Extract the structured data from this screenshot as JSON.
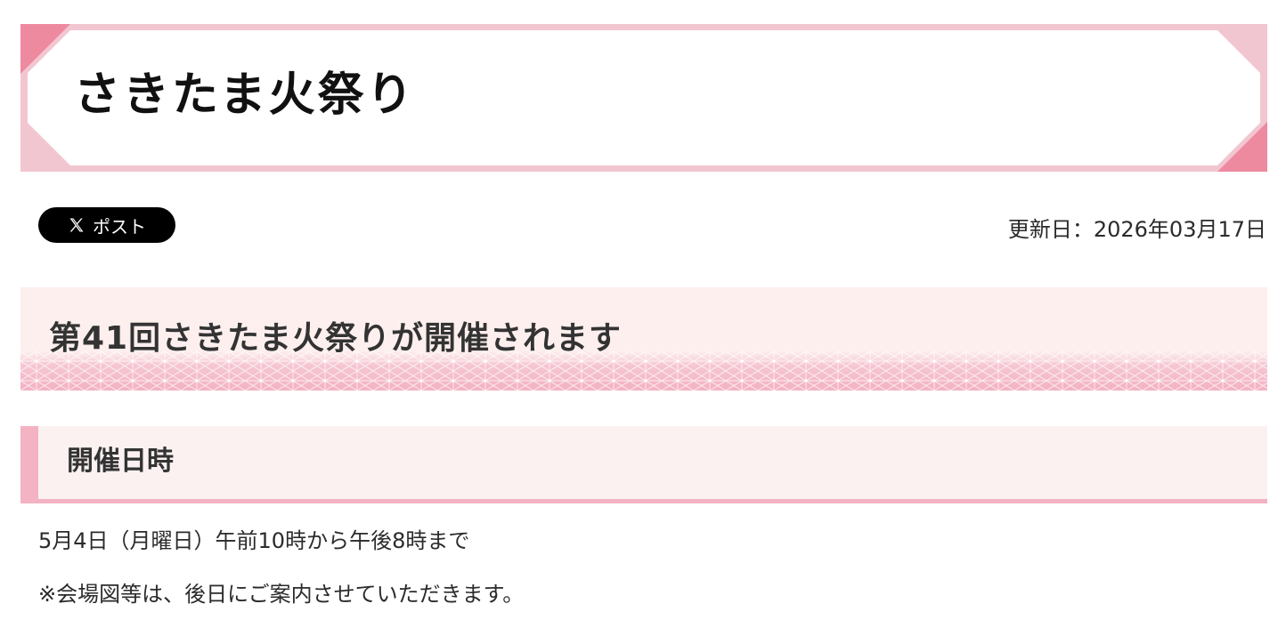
{
  "page": {
    "title": "さきたま火祭り"
  },
  "share": {
    "post_label": "ポスト",
    "icon": "x-logo-icon"
  },
  "updated": {
    "text": "更新日：2026年03月17日"
  },
  "section": {
    "heading": "第41回さきたま火祭りが開催されます"
  },
  "subsection": {
    "heading": "開催日時",
    "paragraphs": [
      "5月4日（月曜日）午前10時から午後8時まで",
      "※会場図等は、後日にご案内させていただきます。"
    ]
  },
  "colors": {
    "accent_pink": "#ee8aa0",
    "light_pink": "#f2c6d1",
    "banner_bg": "#fcefee",
    "heading_bar": "#f3b3c3"
  }
}
